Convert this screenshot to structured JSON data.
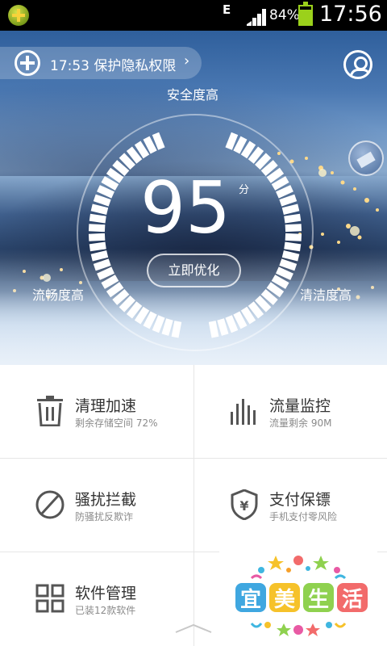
{
  "status_bar": {
    "network": "E",
    "battery_text": "84%",
    "battery_level": 0.84,
    "time": "17:56",
    "battery_color": "#9bd11b"
  },
  "hero": {
    "privacy_banner": "17:53 保护隐私权限",
    "privacy_chevron": "›",
    "label_top": "安全度高",
    "label_left": "流畅度高",
    "label_right": "清洁度高",
    "score": "95",
    "score_unit": "分",
    "score_value": 95,
    "optimize_button": "立即优化"
  },
  "features": [
    {
      "title": "清理加速",
      "subtitle": "剩余存储空间 72%",
      "icon": "trash-icon"
    },
    {
      "title": "流量监控",
      "subtitle": "流量剩余 90M",
      "icon": "bars-icon"
    },
    {
      "title": "骚扰拦截",
      "subtitle": "防骚扰反欺诈",
      "icon": "block-icon"
    },
    {
      "title": "支付保镖",
      "subtitle": "手机支付零风险",
      "icon": "shield-yen-icon"
    },
    {
      "title": "软件管理",
      "subtitle": "已装12款软件",
      "icon": "grid-icon"
    }
  ],
  "watermark": {
    "text": "宜美生活"
  }
}
